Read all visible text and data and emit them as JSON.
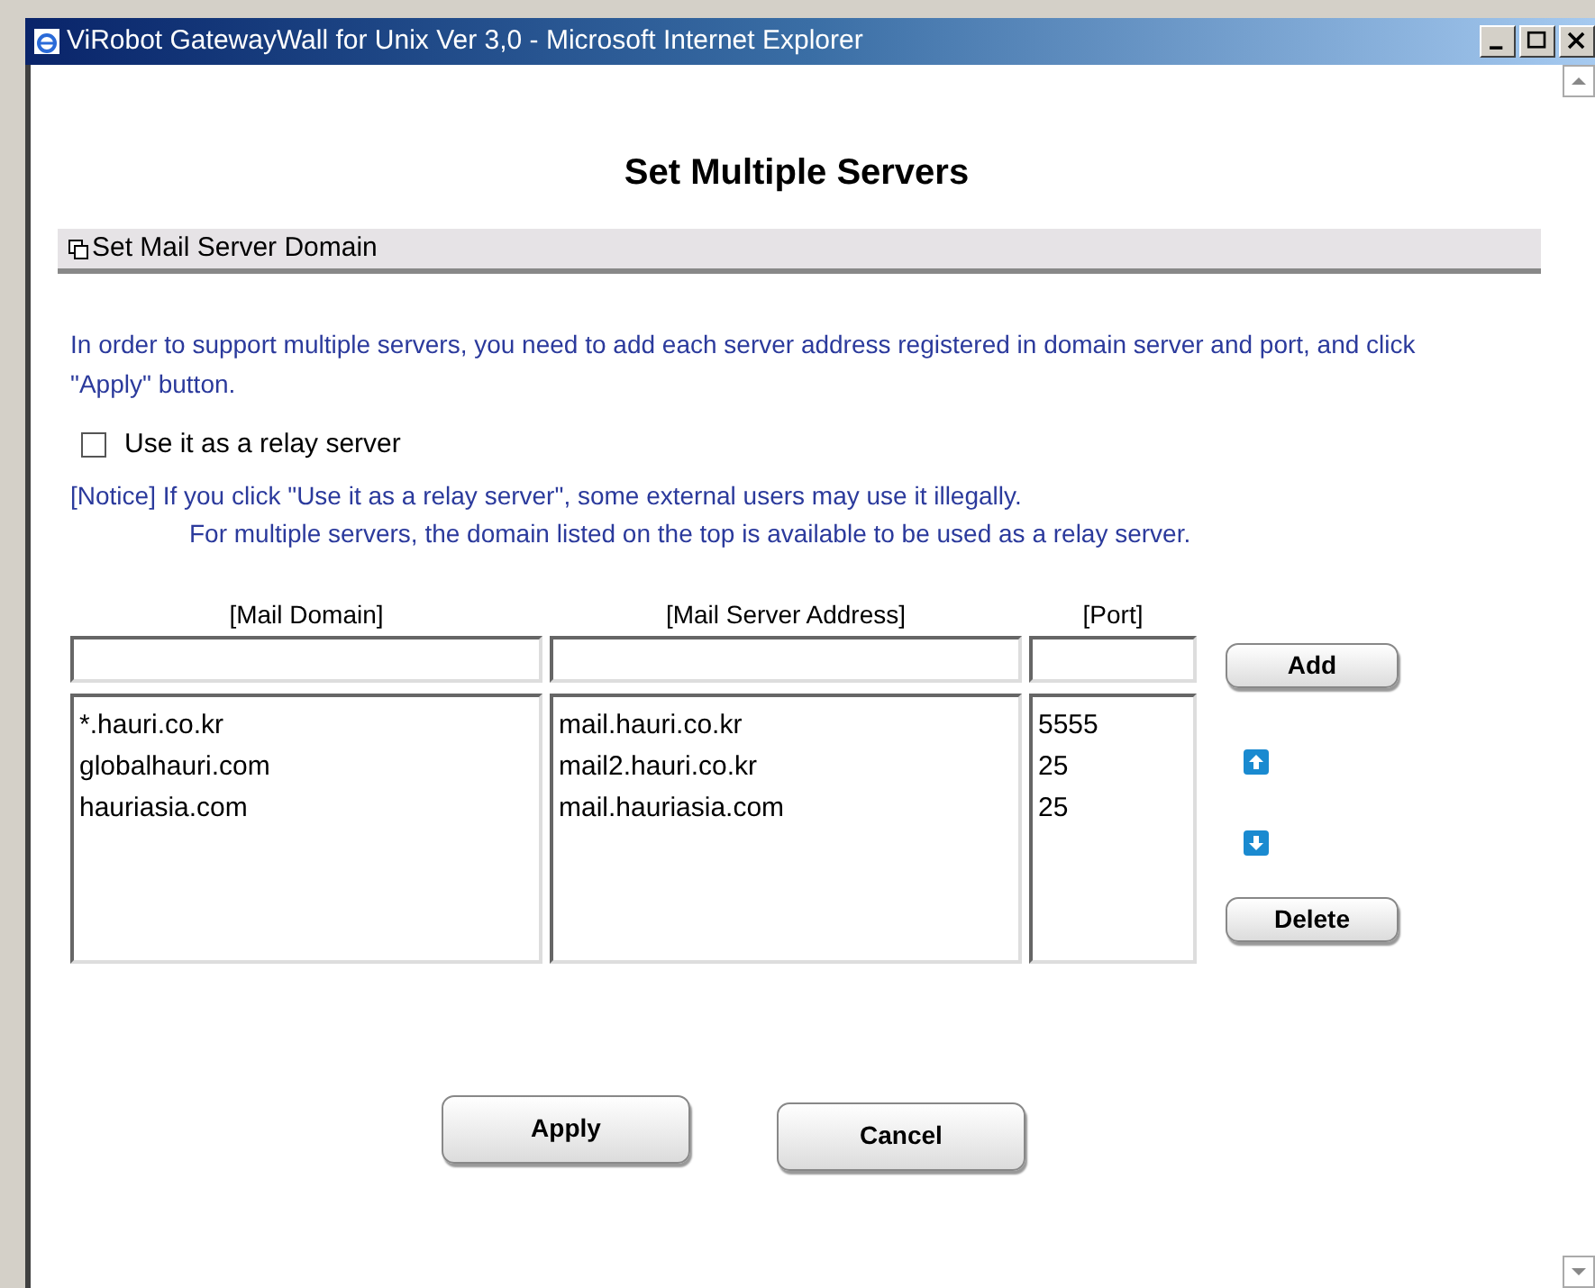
{
  "window": {
    "title": "ViRobot GatewayWall for Unix Ver 3,0 - Microsoft Internet Explorer"
  },
  "heading": "Set Multiple Servers",
  "section": {
    "title": "Set Mail Server Domain"
  },
  "intro": "In order to support multiple servers, you need to add each server address registered in domain server and port, and click \"Apply\" button.",
  "relay": {
    "label": "Use it as a relay server",
    "checked": false
  },
  "notice": [
    "[Notice] If you click \"Use it as a relay server\", some external users may use it illegally.",
    "For multiple servers, the domain listed on the top is available to be used as a relay server."
  ],
  "columns": [
    {
      "header": "[Mail Domain]",
      "items": [
        "*.hauri.co.kr",
        "globalhauri.com",
        "hauriasia.com"
      ]
    },
    {
      "header": "[Mail Server Address]",
      "items": [
        "mail.hauri.co.kr",
        "mail2.hauri.co.kr",
        "mail.hauriasia.com"
      ]
    },
    {
      "header": "[Port]",
      "items": [
        "5555",
        "25",
        "25"
      ]
    }
  ],
  "add_button": "Add",
  "delete_button": "Delete",
  "buttons": [
    "Apply",
    "Cancel"
  ]
}
